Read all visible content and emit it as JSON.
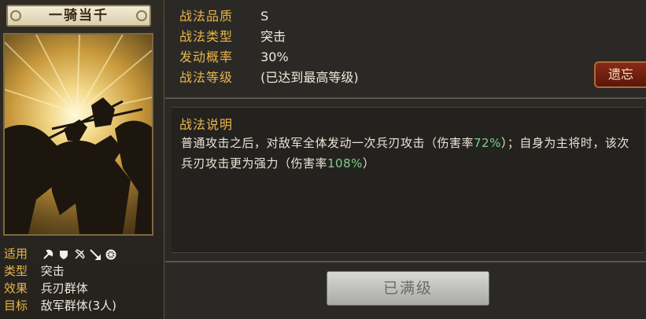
{
  "skill": {
    "name": "一骑当千"
  },
  "card_info": {
    "applicable_label": "适用",
    "applicable_icons": [
      "axe-icon",
      "shield-icon",
      "crossed-bows-icon",
      "spear-icon",
      "wheel-icon"
    ],
    "type_label": "类型",
    "type_value": "突击",
    "effect_label": "效果",
    "effect_value": "兵刃群体",
    "target_label": "目标",
    "target_value": "敌军群体(3人)"
  },
  "stats": {
    "quality_label": "战法品质",
    "quality_value": "S",
    "type_label": "战法类型",
    "type_value": "突击",
    "chance_label": "发动概率",
    "chance_value": "30%",
    "level_label": "战法等级",
    "level_value": "(已达到最高等级)"
  },
  "forget_button": "遗忘",
  "description": {
    "title": "战法说明",
    "part1": "普通攻击之后，对敌军全体发动一次兵刃攻击（伤害率",
    "pct1": "72%",
    "part2": "）；自身为主将时，该次兵刃攻击更为强力（伤害率",
    "pct2": "108%",
    "part3": "）"
  },
  "maxed_button": "已满级",
  "colors": {
    "label_gold": "#e8b64a",
    "percent_green": "#7fd08a",
    "forget_red": "#7a2412"
  }
}
